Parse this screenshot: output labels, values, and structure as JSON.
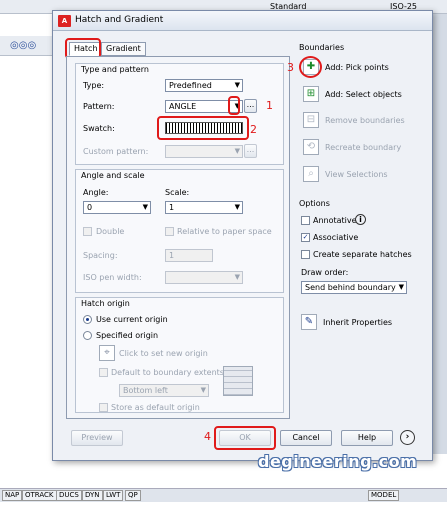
{
  "autocad": {
    "toolbar_standard": "Standard",
    "toolbar_iso": "ISO-25",
    "status_items": [
      "NAP",
      "OTRACK",
      "DUCS",
      "DYN",
      "LWT",
      "QP"
    ],
    "status_model": "MODEL"
  },
  "dialog": {
    "title": "Hatch and Gradient",
    "tabs": [
      "Hatch",
      "Gradient"
    ],
    "type_pattern": {
      "heading": "Type and pattern",
      "type_label": "Type:",
      "type_value": "Predefined",
      "pattern_label": "Pattern:",
      "pattern_value": "ANGLE",
      "ellipsis": "...",
      "swatch_label": "Swatch:",
      "custom_label": "Custom pattern:"
    },
    "angle_scale": {
      "heading": "Angle and scale",
      "angle_label": "Angle:",
      "angle_value": "0",
      "scale_label": "Scale:",
      "scale_value": "1",
      "double_label": "Double",
      "relative_label": "Relative to paper space",
      "spacing_label": "Spacing:",
      "spacing_value": "1",
      "iso_label": "ISO pen width:"
    },
    "hatch_origin": {
      "heading": "Hatch origin",
      "use_current": "Use current origin",
      "specified": "Specified origin",
      "click_set": "Click to set new origin",
      "default_extents": "Default to boundary extents",
      "bottom_left": "Bottom left",
      "store_default": "Store as default origin"
    },
    "boundaries": {
      "heading": "Boundaries",
      "add_pick": "Add: Pick points",
      "add_select": "Add: Select objects",
      "remove": "Remove boundaries",
      "recreate": "Recreate boundary",
      "view": "View Selections"
    },
    "options": {
      "heading": "Options",
      "annotative": "Annotative",
      "info": "i",
      "associative": "Associative",
      "create_separate": "Create separate hatches",
      "draw_order_label": "Draw order:",
      "draw_order_value": "Send behind boundary"
    },
    "inherit": "Inherit Properties",
    "buttons": {
      "preview": "Preview",
      "ok": "OK",
      "cancel": "Cancel",
      "help": "Help"
    }
  },
  "annotations": [
    "1",
    "2",
    "3",
    "4"
  ],
  "watermark": "degineering.com"
}
